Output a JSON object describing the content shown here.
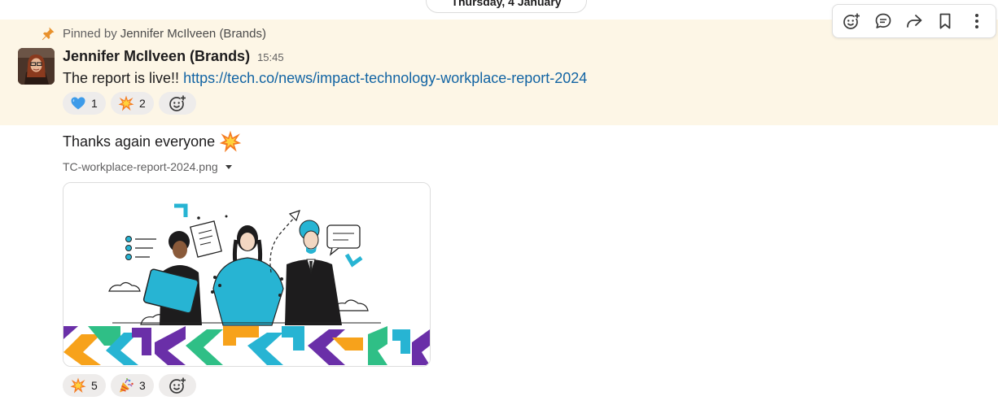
{
  "date_divider": {
    "label": "Thursday, 4 January"
  },
  "pinned": {
    "prefix": "Pinned by",
    "name": "Jennifer McIlveen (Brands)"
  },
  "message": {
    "author": "Jennifer McIlveen (Brands)",
    "time": "15:45",
    "text": "The report is live!!",
    "link": "https://tech.co/news/impact-technology-workplace-report-2024",
    "reactions": [
      {
        "emoji": "blue-heart",
        "count": "1"
      },
      {
        "emoji": "collision",
        "count": "2"
      }
    ]
  },
  "followup": {
    "text": "Thanks again everyone",
    "emoji": "collision",
    "file_name": "TC-workplace-report-2024.png",
    "reactions": [
      {
        "emoji": "collision",
        "count": "5"
      },
      {
        "emoji": "party-popper",
        "count": "3"
      }
    ]
  },
  "toolbar": {
    "actions": [
      "add-reaction",
      "reply-in-thread",
      "forward",
      "save-for-later",
      "more-actions"
    ]
  },
  "colors": {
    "pinned_bg": "#fdf6e6",
    "link": "#1264a3",
    "reaction_bg": "#eeeceb",
    "illustration_cyan": "#27b4d3",
    "illustration_purple": "#6a2fa8",
    "illustration_orange": "#f7a21b",
    "illustration_green": "#2fbf86"
  }
}
